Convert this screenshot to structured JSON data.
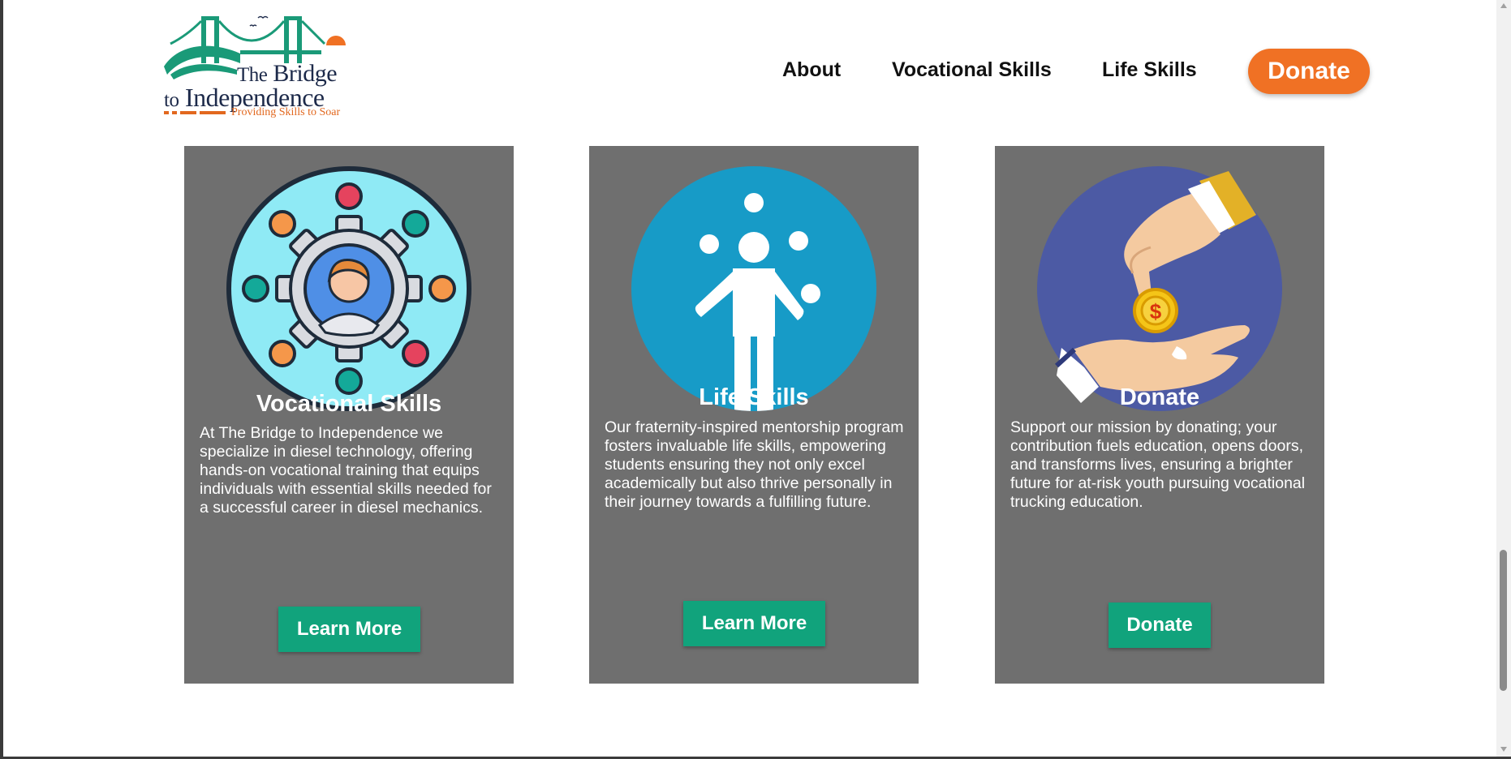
{
  "brand": {
    "logo_line1_the": "The",
    "logo_line1_bridge": "Bridge",
    "logo_line2_to": "to",
    "logo_line2_independence": "Independence",
    "tagline": "Providing Skills to Soar",
    "colors": {
      "green": "#11a37c",
      "orange": "#f07124",
      "navy": "#1d2a4a"
    }
  },
  "nav": {
    "items": [
      {
        "label": "About"
      },
      {
        "label": "Vocational Skills"
      },
      {
        "label": "Life Skills"
      }
    ],
    "donate_label": "Donate"
  },
  "cards": [
    {
      "icon": "gear-person-network-icon",
      "title": "Vocational Skills",
      "description": "At The Bridge to Independence we specialize in diesel technology, offering hands-on vocational training that equips individuals with essential skills needed for a successful career in diesel mechanics.",
      "button_label": "Learn More"
    },
    {
      "icon": "juggling-person-icon",
      "title": "Life Skills",
      "description": "Our fraternity-inspired mentorship program fosters invaluable life skills, empowering students ensuring they not only excel academically but also thrive personally in their journey towards a fulfilling future.",
      "button_label": "Learn More"
    },
    {
      "icon": "hands-coin-donation-icon",
      "title": "Donate",
      "description": "Support our mission by donating; your contribution fuels education, opens doors, and transforms lives, ensuring a brighter future for at-risk youth pursuing vocational trucking education.",
      "button_label": "Donate"
    }
  ],
  "card_colors": {
    "card_bg": "#6f6f6f",
    "button_bg": "#11a37c"
  }
}
